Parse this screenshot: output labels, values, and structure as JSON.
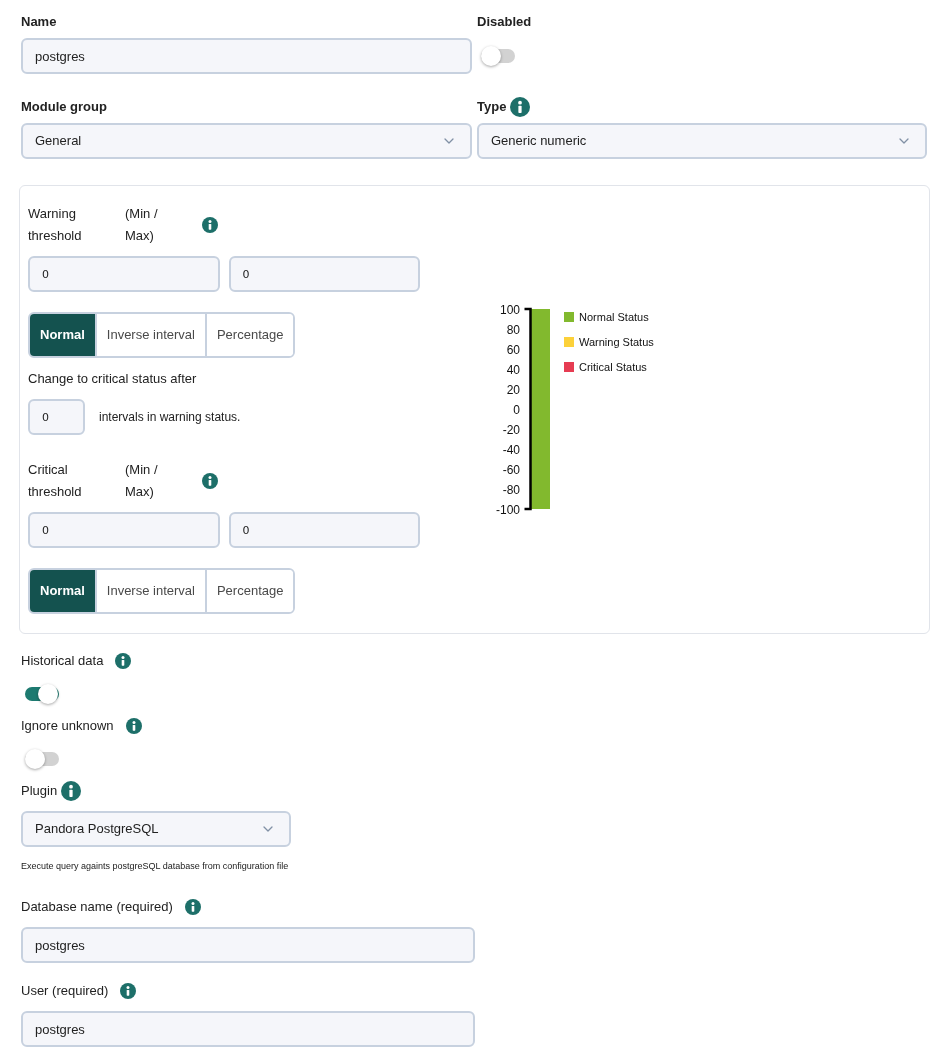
{
  "general": [
    {
      "kind": "text",
      "label": "Name",
      "info": false,
      "value": "postgres"
    },
    {
      "kind": "toggle",
      "label": "Disabled",
      "info": false,
      "on": false
    },
    {
      "kind": "select",
      "label": "Module group",
      "info": false,
      "value": "General"
    },
    {
      "kind": "select",
      "label": "Type",
      "info": true,
      "value": "Generic numeric"
    }
  ],
  "thresholds": {
    "blocks": [
      {
        "kind": "threshold",
        "label": "Warning threshold",
        "range_label": "(Min / Max)",
        "info": true,
        "min": "0",
        "max": "0",
        "modes": [
          {
            "label": "Normal",
            "selected": true
          },
          {
            "label": "Inverse interval",
            "selected": false
          },
          {
            "label": "Percentage",
            "selected": false
          }
        ]
      },
      {
        "kind": "counter",
        "label": "Change to critical status after",
        "value": "0",
        "suffix": "intervals in warning status."
      },
      {
        "kind": "threshold",
        "label": "Critical threshold",
        "range_label": "(Min / Max)",
        "info": true,
        "min": "0",
        "max": "0",
        "modes": [
          {
            "label": "Normal",
            "selected": true
          },
          {
            "label": "Inverse interval",
            "selected": false
          },
          {
            "label": "Percentage",
            "selected": false
          }
        ]
      }
    ],
    "chart_data": {
      "type": "bar",
      "stacked": true,
      "ylim": [
        -100,
        100
      ],
      "yticks": [
        100,
        80,
        60,
        40,
        20,
        0,
        -20,
        -40,
        -60,
        -80,
        -100
      ],
      "series": [
        {
          "name": "Normal Status",
          "color": "#82b92e",
          "values": [
            100
          ]
        },
        {
          "name": "Warning Status",
          "color": "#fcd13a",
          "values": [
            null
          ]
        },
        {
          "name": "Critical Status",
          "color": "#e63c52",
          "values": [
            null
          ]
        },
        {
          "color": "#82b92e",
          "values": [
            -100
          ]
        }
      ]
    }
  },
  "options": [
    {
      "kind": "toggle",
      "label": "Historical data",
      "info": true,
      "on": true
    },
    {
      "kind": "toggle",
      "label": "Ignore unknown",
      "info": true,
      "on": false
    },
    {
      "kind": "select",
      "label": "Plugin",
      "info": true,
      "value": "Pandora PostgreSQL",
      "help": "Execute query againts postgreSQL database from configuration file"
    },
    {
      "kind": "text",
      "label": "Database name (required)",
      "info": true,
      "value": "postgres"
    },
    {
      "kind": "text",
      "label": "User (required)",
      "info": true,
      "value": "postgres"
    }
  ]
}
